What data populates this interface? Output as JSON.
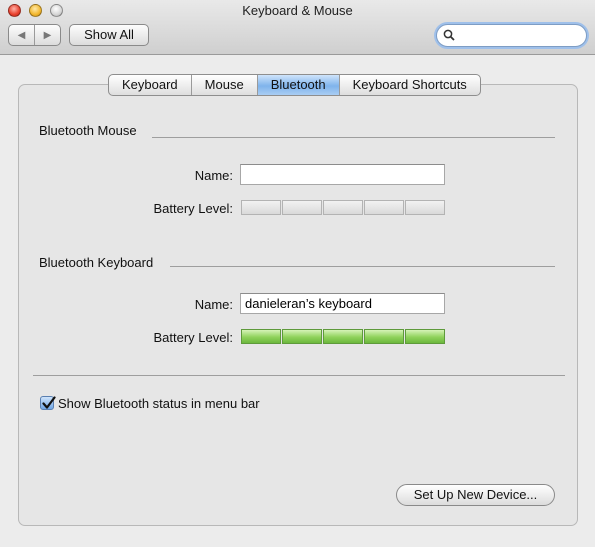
{
  "window": {
    "title": "Keyboard & Mouse"
  },
  "toolbar": {
    "back_glyph": "◀",
    "forward_glyph": "▶",
    "show_all_label": "Show All",
    "search": {
      "value": "",
      "placeholder": ""
    }
  },
  "tabs": [
    {
      "label": "Keyboard",
      "active": false
    },
    {
      "label": "Mouse",
      "active": false
    },
    {
      "label": "Bluetooth",
      "active": true
    },
    {
      "label": "Keyboard Shortcuts",
      "active": false
    }
  ],
  "mouse_section": {
    "title": "Bluetooth Mouse",
    "name_label": "Name:",
    "name_value": "",
    "battery_label": "Battery Level:",
    "battery_level": 0
  },
  "keyboard_section": {
    "title": "Bluetooth Keyboard",
    "name_label": "Name:",
    "name_value": "danieleran’s keyboard",
    "battery_label": "Battery Level:",
    "battery_level": 1.0
  },
  "status_checkbox": {
    "label": "Show Bluetooth status in menu bar",
    "checked": true
  },
  "setup_button_label": "Set Up New Device...",
  "colors": {
    "tab_active": "#7fb4ec",
    "battery_full": "#8fd25b",
    "search_focus": "#9fc0ea"
  },
  "icons": {
    "search": "magnifier-icon",
    "check": "checkmark-icon"
  }
}
